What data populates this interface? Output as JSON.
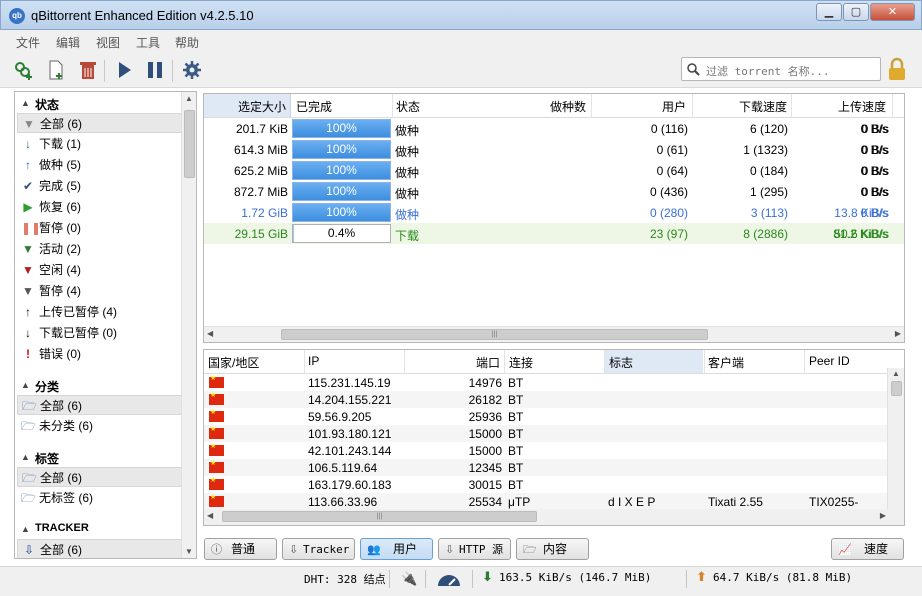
{
  "window": {
    "title": "qBittorrent Enhanced Edition v4.2.5.10",
    "app_badge": "qb"
  },
  "menu": [
    "文件",
    "编辑",
    "视图",
    "工具",
    "帮助"
  ],
  "search": {
    "placeholder": "过滤 torrent 名称..."
  },
  "sidebar": {
    "status_title": "状态",
    "status_items": [
      {
        "label": "全部 (6)",
        "icon": "funnel-icon"
      },
      {
        "label": "下载 (1)",
        "icon": "arrow-down-icon"
      },
      {
        "label": "做种 (5)",
        "icon": "arrow-up-icon"
      },
      {
        "label": "完成 (5)",
        "icon": "check-icon"
      },
      {
        "label": "恢复 (6)",
        "icon": "play-icon"
      },
      {
        "label": "暂停 (0)",
        "icon": "pause-icon"
      },
      {
        "label": "活动 (2)",
        "icon": "funnel-icon"
      },
      {
        "label": "空闲 (4)",
        "icon": "funnel-icon"
      },
      {
        "label": "暂停 (4)",
        "icon": "funnel-icon"
      },
      {
        "label": "上传已暂停 (4)",
        "icon": "arrow-up-icon"
      },
      {
        "label": "下载已暂停 (0)",
        "icon": "arrow-down-icon"
      },
      {
        "label": "错误 (0)",
        "icon": "exclamation-icon"
      }
    ],
    "category_title": "分类",
    "category_items": [
      {
        "label": "全部 (6)"
      },
      {
        "label": "未分类 (6)"
      }
    ],
    "tag_title": "标签",
    "tag_items": [
      {
        "label": "全部 (6)"
      },
      {
        "label": "无标签 (6)"
      }
    ],
    "tracker_title": "TRACKER",
    "tracker_items": [
      {
        "label": "全部 (6)"
      }
    ]
  },
  "torrents": {
    "columns": [
      "选定大小",
      "已完成",
      "状态",
      "做种数",
      "用户",
      "下载速度",
      "上传速度"
    ],
    "rows": [
      {
        "size": "201.7 KiB",
        "progress": "100%",
        "state": "做种",
        "seeds": "0 (116)",
        "peers": "6 (120)",
        "dl": "0 B/s",
        "ul": "0 B/s",
        "style": "normal"
      },
      {
        "size": "614.3 MiB",
        "progress": "100%",
        "state": "做种",
        "seeds": "0 (61)",
        "peers": "1 (1323)",
        "dl": "0 B/s",
        "ul": "0 B/s",
        "style": "normal"
      },
      {
        "size": "625.2 MiB",
        "progress": "100%",
        "state": "做种",
        "seeds": "0 (64)",
        "peers": "0 (184)",
        "dl": "0 B/s",
        "ul": "0 B/s",
        "style": "normal"
      },
      {
        "size": "872.7 MiB",
        "progress": "100%",
        "state": "做种",
        "seeds": "0 (436)",
        "peers": "1 (295)",
        "dl": "0 B/s",
        "ul": "0 B/s",
        "style": "normal"
      },
      {
        "size": "1.72 GiB",
        "progress": "100%",
        "state": "做种",
        "seeds": "0 (280)",
        "peers": "3 (113)",
        "dl": "0 B/s",
        "ul": "13.8 KiB/s",
        "style": "uploading"
      },
      {
        "size": "29.15 GiB",
        "progress": "0.4%",
        "state": "下载",
        "seeds": "23 (97)",
        "peers": "8 (2886)",
        "dl": "81.2 KiB/s",
        "ul": "50.6 KiB/s",
        "style": "downloading"
      }
    ],
    "progress_values": [
      100,
      100,
      100,
      100,
      100,
      0.4
    ]
  },
  "peers": {
    "columns": [
      "国家/地区",
      "IP",
      "端口",
      "连接",
      "标志",
      "客户端",
      "Peer ID"
    ],
    "rows": [
      {
        "ip": "115.231.145.19",
        "port": "14976",
        "conn": "BT",
        "flags": "",
        "client": "",
        "peerid": ""
      },
      {
        "ip": "14.204.155.221",
        "port": "26182",
        "conn": "BT",
        "flags": "",
        "client": "",
        "peerid": ""
      },
      {
        "ip": "59.56.9.205",
        "port": "25936",
        "conn": "BT",
        "flags": "",
        "client": "",
        "peerid": ""
      },
      {
        "ip": "101.93.180.121",
        "port": "15000",
        "conn": "BT",
        "flags": "",
        "client": "",
        "peerid": ""
      },
      {
        "ip": "42.101.243.144",
        "port": "15000",
        "conn": "BT",
        "flags": "",
        "client": "",
        "peerid": ""
      },
      {
        "ip": "106.5.119.64",
        "port": "12345",
        "conn": "BT",
        "flags": "",
        "client": "",
        "peerid": ""
      },
      {
        "ip": "163.179.60.183",
        "port": "30015",
        "conn": "BT",
        "flags": "",
        "client": "",
        "peerid": ""
      },
      {
        "ip": "113.66.33.96",
        "port": "25534",
        "conn": "μTP",
        "flags": "d I X E P",
        "client": "Tixati 2.55",
        "peerid": "TIX0255-"
      }
    ]
  },
  "tabs": [
    {
      "label": "普通",
      "icon": "info-icon"
    },
    {
      "label": "Tracker",
      "icon": "tracker-icon"
    },
    {
      "label": "用户",
      "icon": "users-icon"
    },
    {
      "label": "HTTP 源",
      "icon": "http-icon"
    },
    {
      "label": "内容",
      "icon": "folder-icon"
    }
  ],
  "speed_button": "速度",
  "status": {
    "dht": "DHT: 328 结点",
    "download": "163.5 KiB/s (146.7 MiB)",
    "upload": "64.7 KiB/s (81.8 MiB)"
  },
  "colors": {
    "uploading": "#3a6fd8",
    "downloading": "#2a8a1a",
    "progress": "#3d8ee0"
  }
}
